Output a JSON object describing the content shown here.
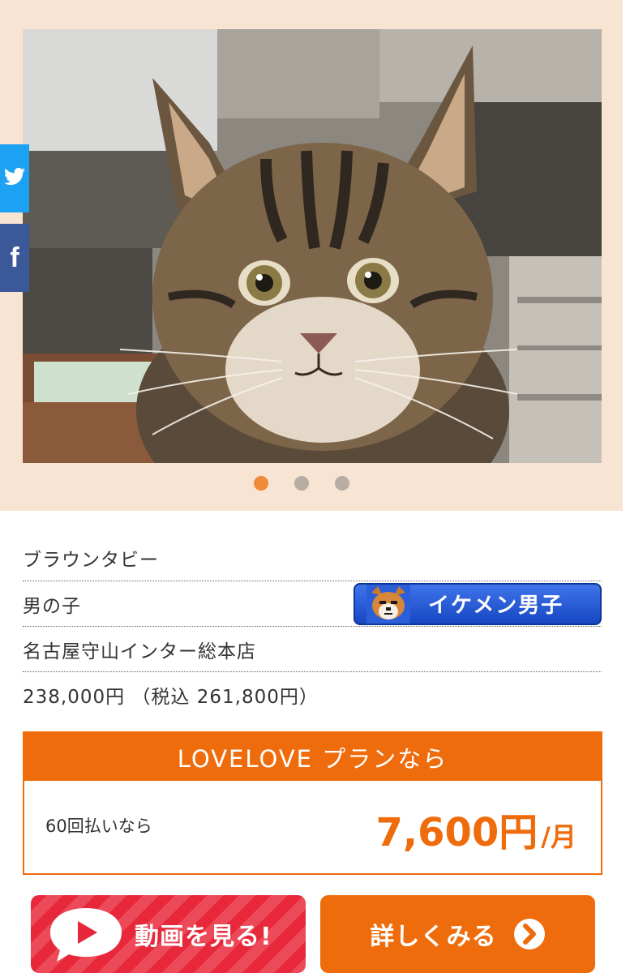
{
  "pet": {
    "breed": "ブラウンタビー",
    "sex": "男の子",
    "badge_label": "イケメン男子",
    "store": "名古屋守山インター総本店",
    "price": "238,000円 （税込 261,800円）"
  },
  "gallery": {
    "active_slide": 1,
    "slide_count": 3
  },
  "plan": {
    "title": "LOVELOVE プランなら",
    "installments_label": "60回払いなら",
    "monthly_amount": "7,600円",
    "per_month": "/月"
  },
  "actions": {
    "video_label": "動画を見る!",
    "detail_label": "詳しくみる"
  },
  "colors": {
    "accent_orange": "#ef6c0c",
    "gallery_bg": "#f8e4d3",
    "video_red": "#e6283a",
    "badge_blue": "#1747c3"
  },
  "icons": {
    "share_twitter": "twitter-icon",
    "share_facebook": "facebook-icon",
    "badge": "dog-face-icon",
    "video": "play-icon",
    "detail": "chevron-right-icon"
  }
}
